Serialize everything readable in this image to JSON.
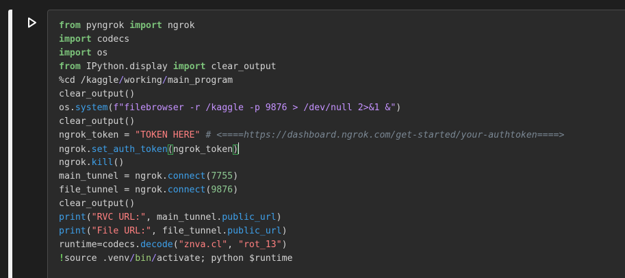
{
  "cell": {
    "run_button_icon": "play-icon",
    "code_lines": [
      [
        [
          "kw",
          "from"
        ],
        [
          "p",
          " pyngrok "
        ],
        [
          "kw",
          "import"
        ],
        [
          "p",
          " ngrok"
        ]
      ],
      [
        [
          "kw",
          "import"
        ],
        [
          "p",
          " codecs"
        ]
      ],
      [
        [
          "kw",
          "import"
        ],
        [
          "p",
          " os"
        ]
      ],
      [
        [
          "kw",
          "from"
        ],
        [
          "p",
          " IPython.display "
        ],
        [
          "kw",
          "import"
        ],
        [
          "p",
          " clear_output"
        ]
      ],
      [
        [
          "p",
          "%cd "
        ],
        [
          "p",
          "/kaggle"
        ],
        [
          "op",
          "/"
        ],
        [
          "p",
          "working"
        ],
        [
          "op",
          "/"
        ],
        [
          "p",
          "main_program"
        ]
      ],
      [
        [
          "p",
          "clear_output()"
        ]
      ],
      [
        [
          "p",
          "os."
        ],
        [
          "fn",
          "system"
        ],
        [
          "p",
          "("
        ],
        [
          "fstr",
          "f\"filebrowser -r /kaggle -p 9876 > /dev/null 2>&1 &\""
        ],
        [
          "p",
          ")"
        ]
      ],
      [
        [
          "p",
          "clear_output()"
        ]
      ],
      [
        [
          "p",
          "ngrok_token = "
        ],
        [
          "str",
          "\"TOKEN HERE\""
        ],
        [
          "p",
          " "
        ],
        [
          "cm",
          "# <====https://dashboard.ngrok.com/get-started/your-authtoken====>"
        ]
      ],
      [
        [
          "p",
          "ngrok."
        ],
        [
          "fn",
          "set_auth_token"
        ],
        [
          "mbr",
          "("
        ],
        [
          "p",
          "ngrok_token"
        ],
        [
          "mbr",
          ")"
        ],
        [
          "cur",
          ""
        ]
      ],
      [
        [
          "p",
          "ngrok."
        ],
        [
          "fn",
          "kill"
        ],
        [
          "p",
          "()"
        ]
      ],
      [
        [
          "p",
          "main_tunnel = ngrok."
        ],
        [
          "fn",
          "connect"
        ],
        [
          "p",
          "("
        ],
        [
          "num",
          "7755"
        ],
        [
          "p",
          ")"
        ]
      ],
      [
        [
          "p",
          "file_tunnel = ngrok."
        ],
        [
          "fn",
          "connect"
        ],
        [
          "p",
          "("
        ],
        [
          "num",
          "9876"
        ],
        [
          "p",
          ")"
        ]
      ],
      [
        [
          "p",
          "clear_output()"
        ]
      ],
      [
        [
          "fn",
          "print"
        ],
        [
          "p",
          "("
        ],
        [
          "str",
          "\"RVC URL:\""
        ],
        [
          "p",
          ", main_tunnel."
        ],
        [
          "fn",
          "public_url"
        ],
        [
          "p",
          ")"
        ]
      ],
      [
        [
          "fn",
          "print"
        ],
        [
          "p",
          "("
        ],
        [
          "str",
          "\"File URL:\""
        ],
        [
          "p",
          ", file_tunnel."
        ],
        [
          "fn",
          "public_url"
        ],
        [
          "p",
          ")"
        ]
      ],
      [
        [
          "p",
          "runtime=codecs."
        ],
        [
          "fn",
          "decode"
        ],
        [
          "p",
          "("
        ],
        [
          "str",
          "\"znva.cl\""
        ],
        [
          "p",
          ", "
        ],
        [
          "str",
          "\"rot_13\""
        ],
        [
          "p",
          ")"
        ]
      ],
      [
        [
          "bang",
          "!"
        ],
        [
          "p",
          "source .venv"
        ],
        [
          "op",
          "/"
        ],
        [
          "magic",
          "bin"
        ],
        [
          "op",
          "/"
        ],
        [
          "p",
          "activate; python $runtime"
        ]
      ]
    ]
  },
  "colors": {
    "background": "#1e1e1e",
    "editor_bg": "#2a2a2a",
    "keyword": "#7cc37a",
    "function": "#3ea0ea",
    "string": "#ff8080",
    "fstring": "#c592ff",
    "number": "#8dc891",
    "comment": "#7a8793"
  }
}
